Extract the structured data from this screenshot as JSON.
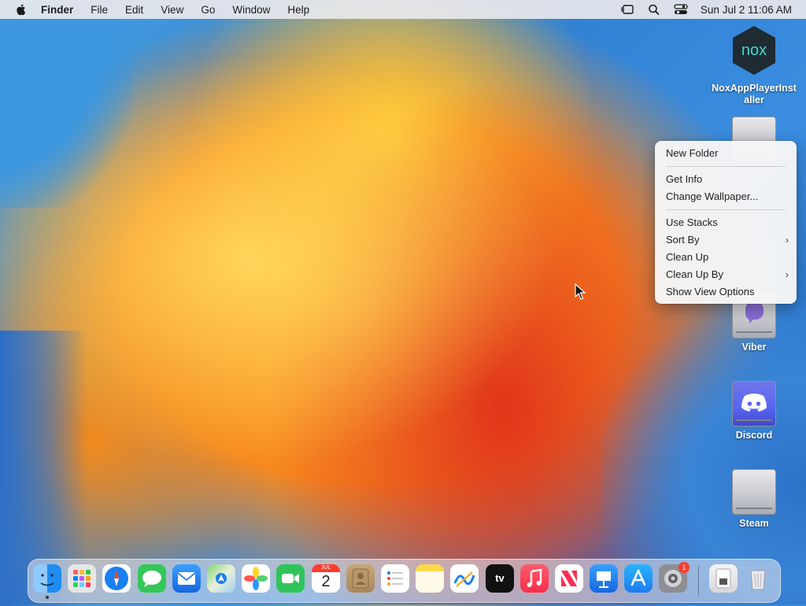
{
  "menubar": {
    "app_name": "Finder",
    "menus": [
      "File",
      "Edit",
      "View",
      "Go",
      "Window",
      "Help"
    ],
    "clock": "Sun Jul 2  11:06 AM",
    "icons": [
      "stage-manager-icon",
      "spotlight-search-icon",
      "control-center-icon"
    ]
  },
  "desktop": {
    "icons": [
      {
        "name": "nox-installer",
        "label_line1": "NoxAppPlayerInst",
        "label_line2": "aller",
        "icon": "nox-logo-icon"
      },
      {
        "name": "viber",
        "label": "Viber",
        "icon": "disk-icon"
      },
      {
        "name": "discord",
        "label": "Discord",
        "icon": "disk-icon"
      },
      {
        "name": "steam",
        "label": "Steam",
        "icon": "disk-icon"
      }
    ]
  },
  "context_menu": {
    "items": [
      {
        "label": "New Folder"
      },
      {
        "label": "Get Info"
      },
      {
        "label": "Change Wallpaper..."
      },
      {
        "label": "Use Stacks"
      },
      {
        "label": "Sort By",
        "submenu": true
      },
      {
        "label": "Clean Up"
      },
      {
        "label": "Clean Up By",
        "submenu": true
      },
      {
        "label": "Show View Options"
      }
    ],
    "chevron": "›"
  },
  "dock": {
    "apps": [
      "Finder",
      "Launchpad",
      "Safari",
      "Messages",
      "Mail",
      "Maps",
      "Photos",
      "FaceTime",
      "Calendar",
      "Contacts",
      "Reminders",
      "Notes",
      "Freeform",
      "TV",
      "Music",
      "News",
      "Keynote",
      "App Store",
      "System Settings"
    ],
    "calendar_month": "JUL",
    "calendar_day": "2",
    "tv_text": "tv",
    "settings_badge": "1",
    "extras": [
      "Downloads",
      "Trash"
    ],
    "colors": {
      "finder": "#1e8cf0",
      "safari": "#1a7ff0",
      "messages": "#34c759",
      "facetime": "#30c45a",
      "music": "#fa2d48",
      "news": "#ff2d55",
      "appstore": "#1e90ff"
    }
  }
}
